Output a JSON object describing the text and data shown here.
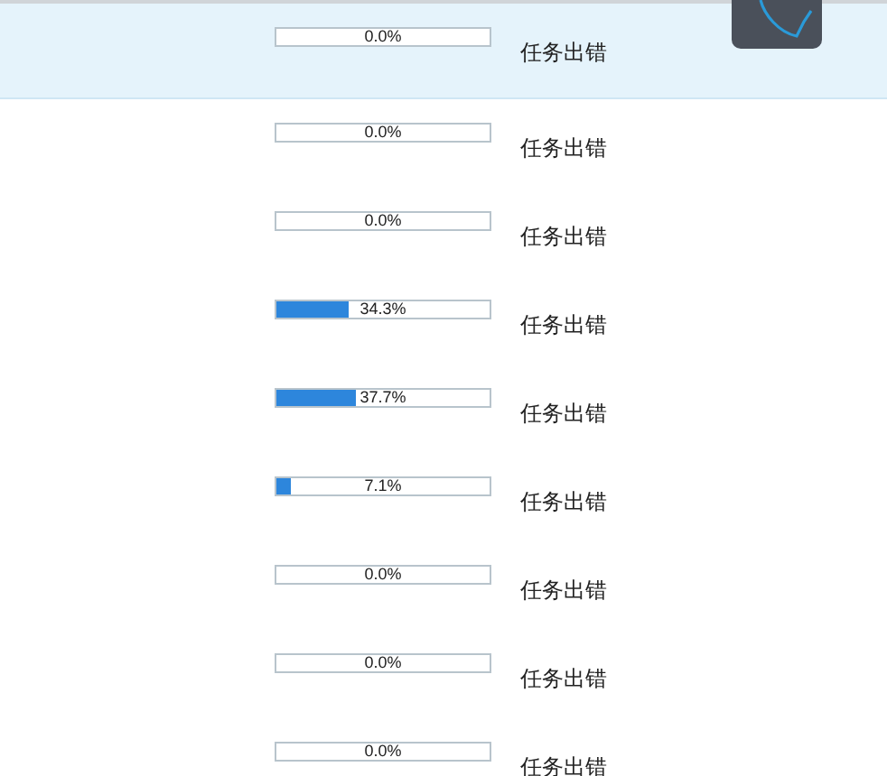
{
  "tasks": [
    {
      "progress": "0.0%",
      "level": 0,
      "status": "任务出错",
      "selected": true
    },
    {
      "progress": "0.0%",
      "level": 0,
      "status": "任务出错",
      "selected": false
    },
    {
      "progress": "0.0%",
      "level": 0,
      "status": "任务出错",
      "selected": false
    },
    {
      "progress": "34.3%",
      "level": 0.343,
      "status": "任务出错",
      "selected": false
    },
    {
      "progress": "37.7%",
      "level": 0.377,
      "status": "任务出错",
      "selected": false
    },
    {
      "progress": "7.1%",
      "level": 0.071,
      "status": "任务出错",
      "selected": false
    },
    {
      "progress": "0.0%",
      "level": 0,
      "status": "任务出错",
      "selected": false
    },
    {
      "progress": "0.0%",
      "level": 0,
      "status": "任务出错",
      "selected": false
    },
    {
      "progress": "0.0%",
      "level": 0,
      "status": "任务出错",
      "selected": false
    }
  ]
}
